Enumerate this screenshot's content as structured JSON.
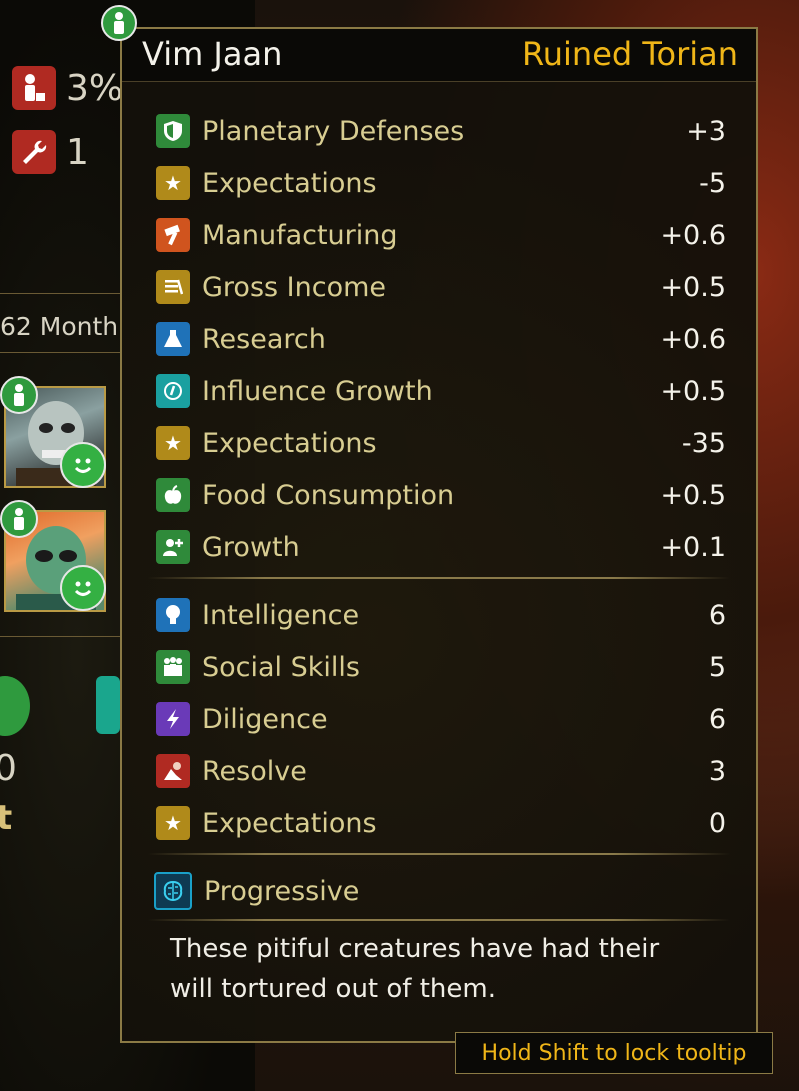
{
  "left_panel": {
    "stat1_value": "3%",
    "stat2_value": "1",
    "months_label": "62 Month",
    "value_bottom": "0",
    "label_bottom": "t"
  },
  "tooltip": {
    "name": "Vim Jaan",
    "species": "Ruined Torian",
    "effects": [
      {
        "label": "Planetary Defenses",
        "value": "+3",
        "icon": "shield-icon",
        "color": "#2f8a3a"
      },
      {
        "label": "Expectations",
        "value": "-5",
        "icon": "star-icon",
        "color": "#b08a1a"
      },
      {
        "label": "Manufacturing",
        "value": "+0.6",
        "icon": "hammer-icon",
        "color": "#d0541e"
      },
      {
        "label": "Gross Income",
        "value": "+0.5",
        "icon": "income-icon",
        "color": "#b08a1a"
      },
      {
        "label": "Research",
        "value": "+0.6",
        "icon": "flask-icon",
        "color": "#1f72b8"
      },
      {
        "label": "Influence Growth",
        "value": "+0.5",
        "icon": "influence-icon",
        "color": "#1aa0a0"
      },
      {
        "label": "Expectations",
        "value": "-35",
        "icon": "star-icon",
        "color": "#b08a1a"
      },
      {
        "label": "Food Consumption",
        "value": "+0.5",
        "icon": "apple-icon",
        "color": "#2f8a3a"
      },
      {
        "label": "Growth",
        "value": "+0.1",
        "icon": "growth-icon",
        "color": "#2f8a3a"
      }
    ],
    "attributes": [
      {
        "label": "Intelligence",
        "value": "6",
        "icon": "bulb-icon",
        "color": "#1f72b8"
      },
      {
        "label": "Social Skills",
        "value": "5",
        "icon": "people-icon",
        "color": "#2f8a3a"
      },
      {
        "label": "Diligence",
        "value": "6",
        "icon": "lightning-icon",
        "color": "#6a3ab8"
      },
      {
        "label": "Resolve",
        "value": "3",
        "icon": "resolve-icon",
        "color": "#b02a22"
      },
      {
        "label": "Expectations",
        "value": "0",
        "icon": "star-icon",
        "color": "#b08a1a"
      }
    ],
    "trait": {
      "label": "Progressive",
      "icon": "brain-icon",
      "color": "#1aa0c8"
    },
    "description": "These pitiful creatures have had their will tortured out of them.",
    "hint": "Hold Shift to lock tooltip"
  }
}
